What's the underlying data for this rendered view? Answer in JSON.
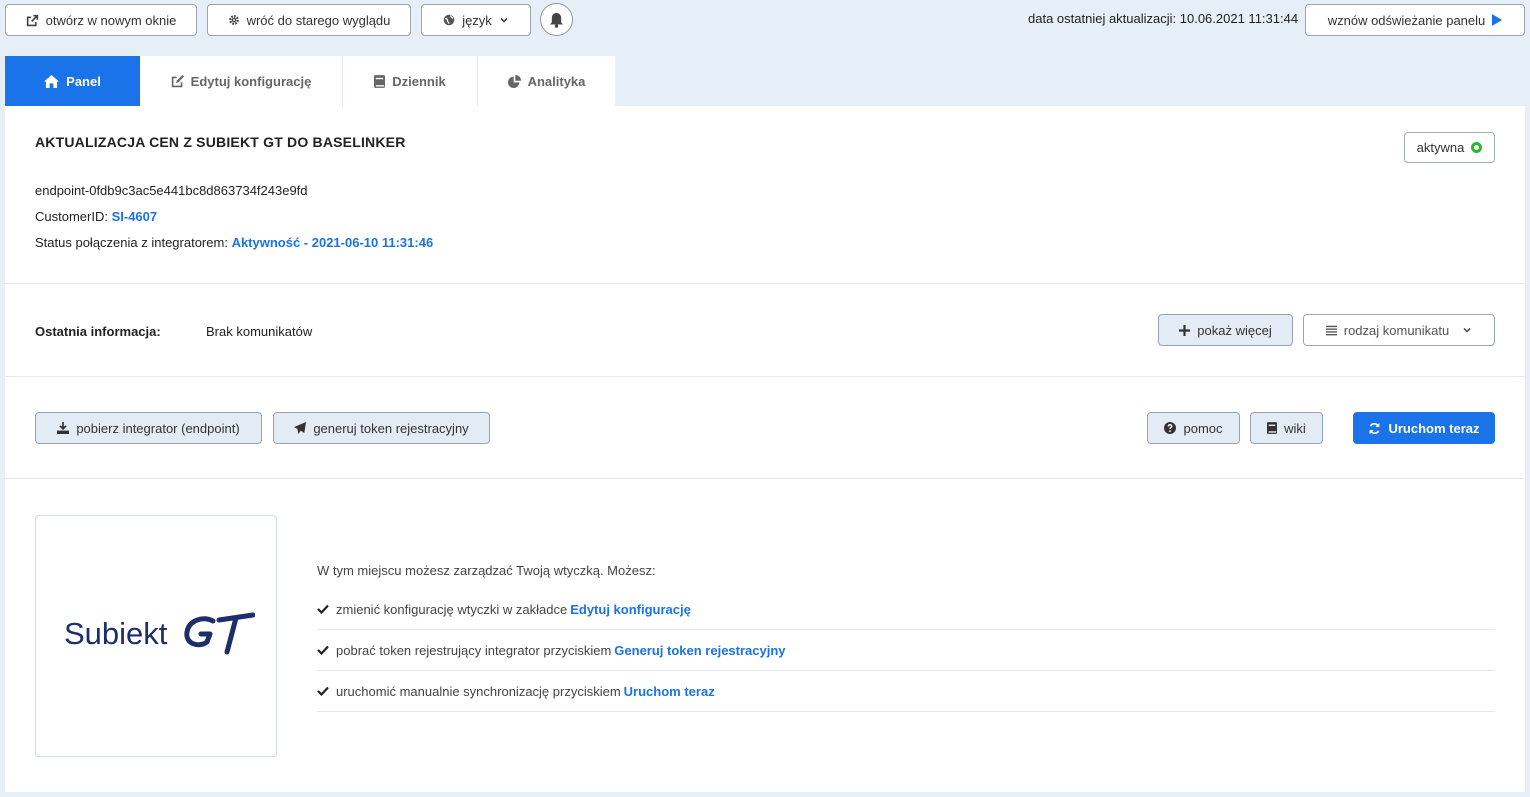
{
  "toolbar": {
    "open_new_window": "otwórz w nowym oknie",
    "back_old_look": "wróć do starego wyglądu",
    "language": "język",
    "update_label": "data ostatniej aktualizacji: 10.06.2021 11:31:44",
    "resume_refresh": "wznów odświeżanie panelu"
  },
  "tabs": [
    {
      "label": "Panel",
      "icon": "home-icon"
    },
    {
      "label": "Edytuj konfigurację",
      "icon": "edit-icon"
    },
    {
      "label": "Dziennik",
      "icon": "book-icon"
    },
    {
      "label": "Analityka",
      "icon": "pie-chart-icon"
    }
  ],
  "header": {
    "title": "AKTUALIZACJA CEN Z SUBIEKT GT DO BASELINKER",
    "status": "aktywna",
    "status_color": "#2eb82e",
    "endpoint": "endpoint-0fdb9c3ac5e441bc8d863734f243e9fd",
    "customer_label": "CustomerID: ",
    "customer_id": "SI-4607",
    "connection_label": "Status połączenia z integratorem: ",
    "connection_value": "Aktywność - 2021-06-10 11:31:46"
  },
  "messages": {
    "label": "Ostatnia informacja:",
    "value": "Brak komunikatów",
    "show_more": "pokaż więcej",
    "message_type": "rodzaj komunikatu"
  },
  "actions": {
    "download": "pobierz integrator (endpoint)",
    "generate_token": "generuj token rejestracyjny",
    "help": "pomoc",
    "wiki": "wiki",
    "run_now": "Uruchom teraz"
  },
  "logo": {
    "text": "Subiekt",
    "alt": "GT"
  },
  "help": {
    "intro": "W tym miejscu możesz zarządzać Twoją wtyczką. Możesz:",
    "items": [
      {
        "text": "zmienić konfigurację wtyczki w zakładce",
        "link": "Edytuj konfigurację"
      },
      {
        "text": "pobrać token rejestrujący integrator przyciskiem",
        "link": "Generuj token rejestracyjny"
      },
      {
        "text": "uruchomić manualnie synchronizację przyciskiem",
        "link": "Uruchom teraz"
      }
    ]
  },
  "colors": {
    "accent": "#1a73e8",
    "background": "#e6eef7",
    "logo_blue": "#1d2f6b"
  }
}
